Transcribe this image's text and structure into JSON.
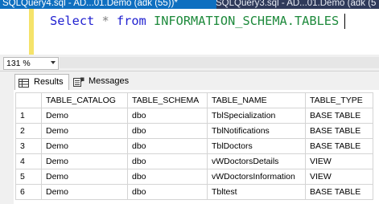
{
  "tabs": {
    "active": "SQLQuery4.sql - AD...01.Demo (adk (55))*",
    "inactive": "SQLQuery3.sql - AD...01.Demo (adk (5"
  },
  "editor": {
    "keyword_select": "Select",
    "star": "*",
    "keyword_from": "from",
    "object": "INFORMATION_SCHEMA.TABLES"
  },
  "zoom": {
    "value": "131 %"
  },
  "result_tabs": {
    "results": "Results",
    "messages": "Messages"
  },
  "grid": {
    "columns": [
      "TABLE_CATALOG",
      "TABLE_SCHEMA",
      "TABLE_NAME",
      "TABLE_TYPE"
    ],
    "rows": [
      [
        "1",
        "Demo",
        "dbo",
        "TblSpecialization",
        "BASE TABLE"
      ],
      [
        "2",
        "Demo",
        "dbo",
        "TblNotifications",
        "BASE TABLE"
      ],
      [
        "3",
        "Demo",
        "dbo",
        "TblDoctors",
        "BASE TABLE"
      ],
      [
        "4",
        "Demo",
        "dbo",
        "vWDoctorsDetails",
        "VIEW"
      ],
      [
        "5",
        "Demo",
        "dbo",
        "vWDoctorsInformation",
        "VIEW"
      ],
      [
        "6",
        "Demo",
        "dbo",
        "Tbltest",
        "BASE TABLE"
      ]
    ]
  },
  "colors": {
    "tab_active": "#0e6fc0",
    "tab_strip": "#2f3a5a",
    "sql_keyword": "#1f1fd0",
    "sql_object": "#1e8a3c",
    "change_bar": "#f5e36a"
  },
  "icons": {
    "results": "grid-icon",
    "messages": "messages-icon",
    "zoom": "chevron-down-icon"
  }
}
